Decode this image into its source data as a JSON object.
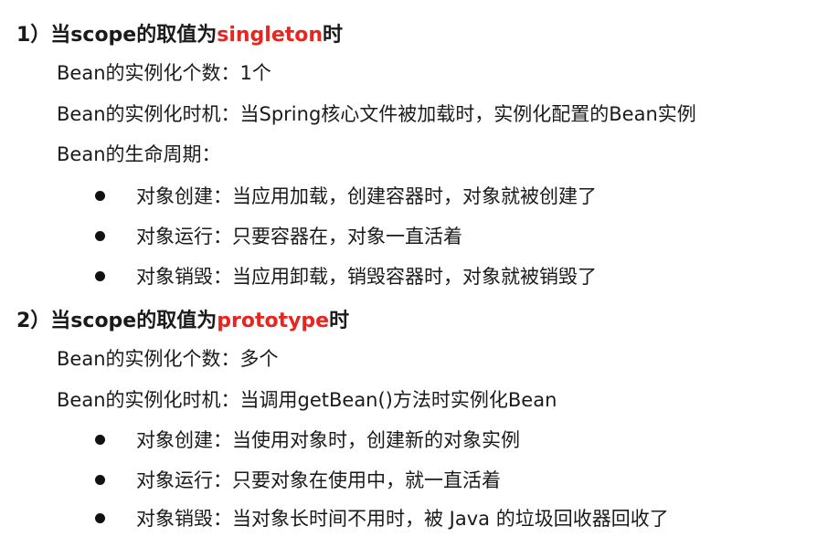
{
  "section1": {
    "prefix": "1）当scope的取值为",
    "keyword": "singleton",
    "suffix": "时",
    "lines": [
      "Bean的实例化个数：1个",
      "Bean的实例化时机：当Spring核心文件被加载时，实例化配置的Bean实例",
      "Bean的生命周期："
    ],
    "bullets": [
      "对象创建：当应用加载，创建容器时，对象就被创建了",
      "对象运行：只要容器在，对象一直活着",
      "对象销毁：当应用卸载，销毁容器时，对象就被销毁了"
    ]
  },
  "section2": {
    "prefix": "2）当scope的取值为",
    "keyword": "prototype",
    "suffix": "时",
    "lines": [
      "Bean的实例化个数：多个",
      "Bean的实例化时机：当调用getBean()方法时实例化Bean"
    ],
    "bullets": [
      "对象创建：当使用对象时，创建新的对象实例",
      "对象运行：只要对象在使用中，就一直活着",
      "对象销毁：当对象长时间不用时，被 Java 的垃圾回收器回收了"
    ]
  },
  "colors": {
    "keyword": "#e8251e",
    "text": "#1a1a1a"
  }
}
